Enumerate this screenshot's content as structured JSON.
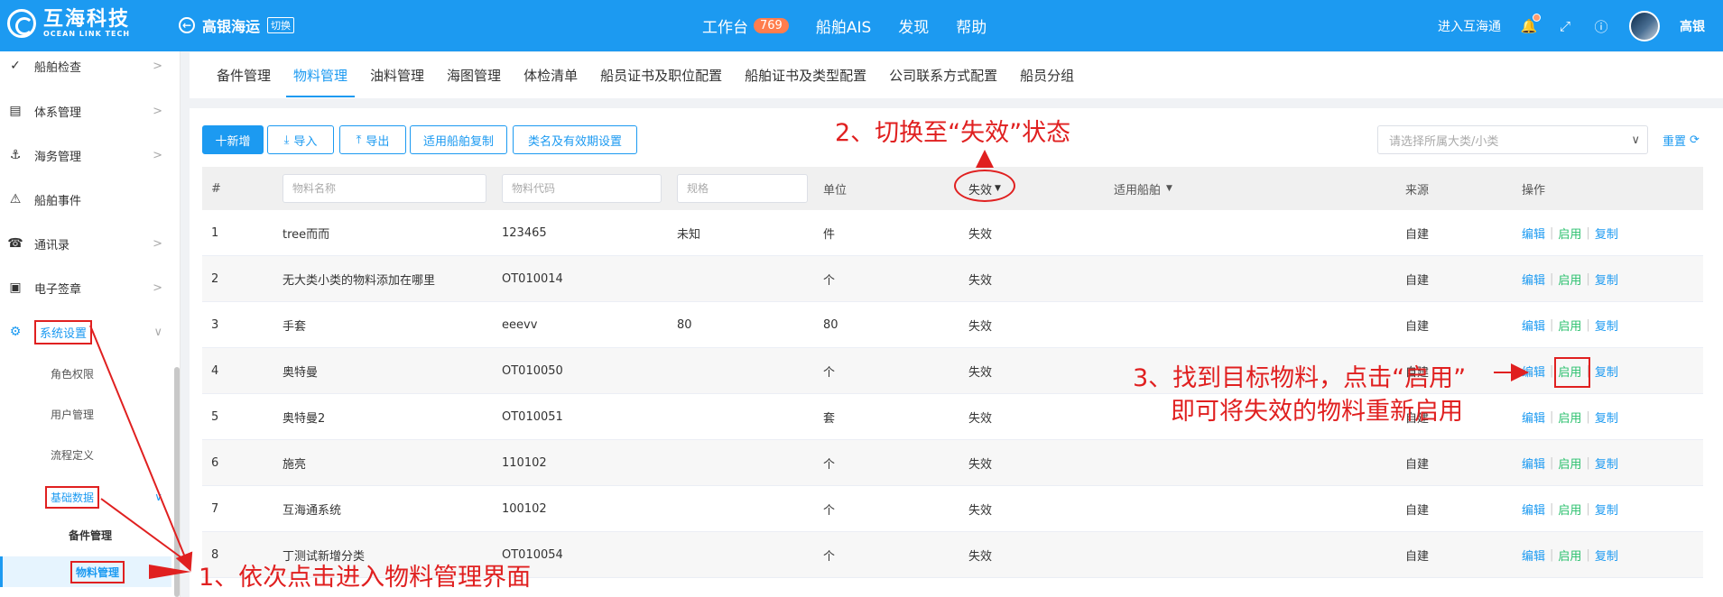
{
  "header": {
    "logo_cn": "互海科技",
    "logo_en": "OCEAN LINK TECH",
    "company": "高银海运",
    "switch_label": "切换",
    "nav": [
      {
        "label": "工作台",
        "badge": "769"
      },
      {
        "label": "船舶AIS"
      },
      {
        "label": "发现"
      },
      {
        "label": "帮助"
      }
    ],
    "enter_label": "进入互海通",
    "user_name": "高银",
    "accent": "#1c9af1"
  },
  "sidebar": {
    "items": [
      {
        "label": "船舶检查",
        "icon": "check-circle-icon"
      },
      {
        "label": "体系管理",
        "icon": "document-icon"
      },
      {
        "label": "海务管理",
        "icon": "anchor-icon"
      },
      {
        "label": "船舶事件",
        "icon": "warning-icon"
      },
      {
        "label": "通讯录",
        "icon": "contacts-icon"
      },
      {
        "label": "电子签章",
        "icon": "stamp-icon"
      },
      {
        "label": "系统设置",
        "icon": "gear-icon"
      }
    ],
    "sub_items": [
      "角色权限",
      "用户管理",
      "流程定义",
      "基础数据"
    ],
    "sub_sub_items": [
      "备件管理",
      "物料管理"
    ]
  },
  "tabs": [
    "备件管理",
    "物料管理",
    "油料管理",
    "海图管理",
    "体检清单",
    "船员证书及职位配置",
    "船舶证书及类型配置",
    "公司联系方式配置",
    "船员分组"
  ],
  "toolbar": {
    "add": "十新增",
    "import": "导入",
    "export": "导出",
    "copy_ship": "适用船舶复制",
    "category_setting": "类名及有效期设置",
    "category_placeholder": "请选择所属大类/小类",
    "reset": "重置"
  },
  "table": {
    "headers": {
      "index": "#",
      "name_placeholder": "物料名称",
      "code_placeholder": "物料代码",
      "spec_placeholder": "规格",
      "unit": "单位",
      "status": "失效",
      "ship": "适用船舶",
      "source": "来源",
      "ops": "操作"
    },
    "op_labels": {
      "edit": "编辑",
      "enable": "启用",
      "copy": "复制"
    },
    "rows": [
      {
        "idx": "1",
        "name": "tree而而",
        "code": "123465",
        "spec": "未知",
        "unit": "件",
        "status": "失效",
        "source": "自建"
      },
      {
        "idx": "2",
        "name": "无大类小类的物料添加在哪里",
        "code": "OT010014",
        "spec": "",
        "unit": "个",
        "status": "失效",
        "source": "自建"
      },
      {
        "idx": "3",
        "name": "手套",
        "code": "eeevv",
        "spec": "80",
        "unit": "80",
        "status": "失效",
        "source": "自建"
      },
      {
        "idx": "4",
        "name": "奥特曼",
        "code": "OT010050",
        "spec": "",
        "unit": "个",
        "status": "失效",
        "source": "自建"
      },
      {
        "idx": "5",
        "name": "奥特曼2",
        "code": "OT010051",
        "spec": "",
        "unit": "套",
        "status": "失效",
        "source": "自建"
      },
      {
        "idx": "6",
        "name": "施亮",
        "code": "110102",
        "spec": "",
        "unit": "个",
        "status": "失效",
        "source": "自建"
      },
      {
        "idx": "7",
        "name": "互海通系统",
        "code": "100102",
        "spec": "",
        "unit": "个",
        "status": "失效",
        "source": "自建"
      },
      {
        "idx": "8",
        "name": "丁测试新增分类",
        "code": "OT010054",
        "spec": "",
        "unit": "个",
        "status": "失效",
        "source": "自建"
      }
    ]
  },
  "annotations": {
    "step1": "1、依次点击进入物料管理界面",
    "step2": "2、切换至“失效”状态",
    "step3_line1": "3、找到目标物料，点击“启用”",
    "step3_line2": "即可将失效的物料重新启用",
    "color": "#e02020"
  }
}
